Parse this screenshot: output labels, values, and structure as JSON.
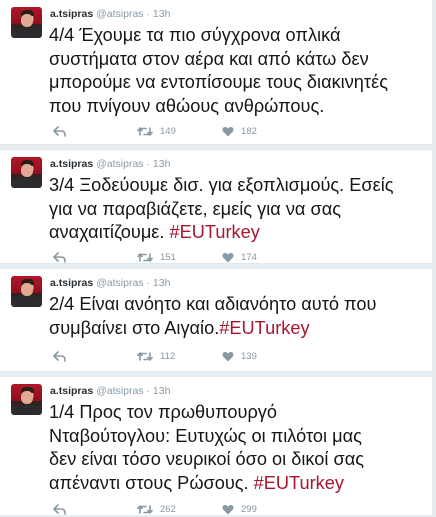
{
  "tweets": [
    {
      "author_name": "a.tsipras",
      "handle": "@atsipras",
      "separator": "·",
      "time": "13h",
      "text": "4/4 Έχουμε τα πιο σύγχρονα οπλικά\nσυστήματα στον αέρα και από κάτω δεν\nμπορούμε να εντοπίσουμε τους διακινητές\nπου πνίγουν αθώους ανθρώπους.",
      "hashtag": "",
      "retweets": "149",
      "likes": "182"
    },
    {
      "author_name": "a.tsipras",
      "handle": "@atsipras",
      "separator": "·",
      "time": "13h",
      "text": "3/4 Ξοδεύουμε δισ. για εξοπλισμούς. Εσείς\nγια να παραβιάζετε, εμείς για να σας\nαναχαιτίζουμε. ",
      "hashtag": "#EUTurkey",
      "retweets": "151",
      "likes": "174"
    },
    {
      "author_name": "a.tsipras",
      "handle": "@atsipras",
      "separator": "·",
      "time": "13h",
      "text": "2/4 Είναι ανόητο και αδιανόητο αυτό που\nσυμβαίνει στο Αιγαίο.",
      "hashtag": "#EUTurkey",
      "retweets": "112",
      "likes": "139"
    },
    {
      "author_name": "a.tsipras",
      "handle": "@atsipras",
      "separator": "·",
      "time": "13h",
      "text": "1/4 Προς τον πρωθυπουργό\nΝταβούτογλου: Ευτυχώς οι πιλότοι μας\nδεν είναι τόσο νευρικοί όσο οι δικοί σας\nαπέναντι στους Ρώσους. ",
      "hashtag": "#EUTurkey",
      "retweets": "262",
      "likes": "299"
    }
  ],
  "icons": {
    "reply": "reply-icon",
    "retweet": "retweet-icon",
    "like": "heart-icon"
  },
  "colors": {
    "background": "#e6ecf0",
    "card": "#ffffff",
    "hashtag": "#a6162d",
    "muted": "#8899a6",
    "text": "#14171a"
  }
}
